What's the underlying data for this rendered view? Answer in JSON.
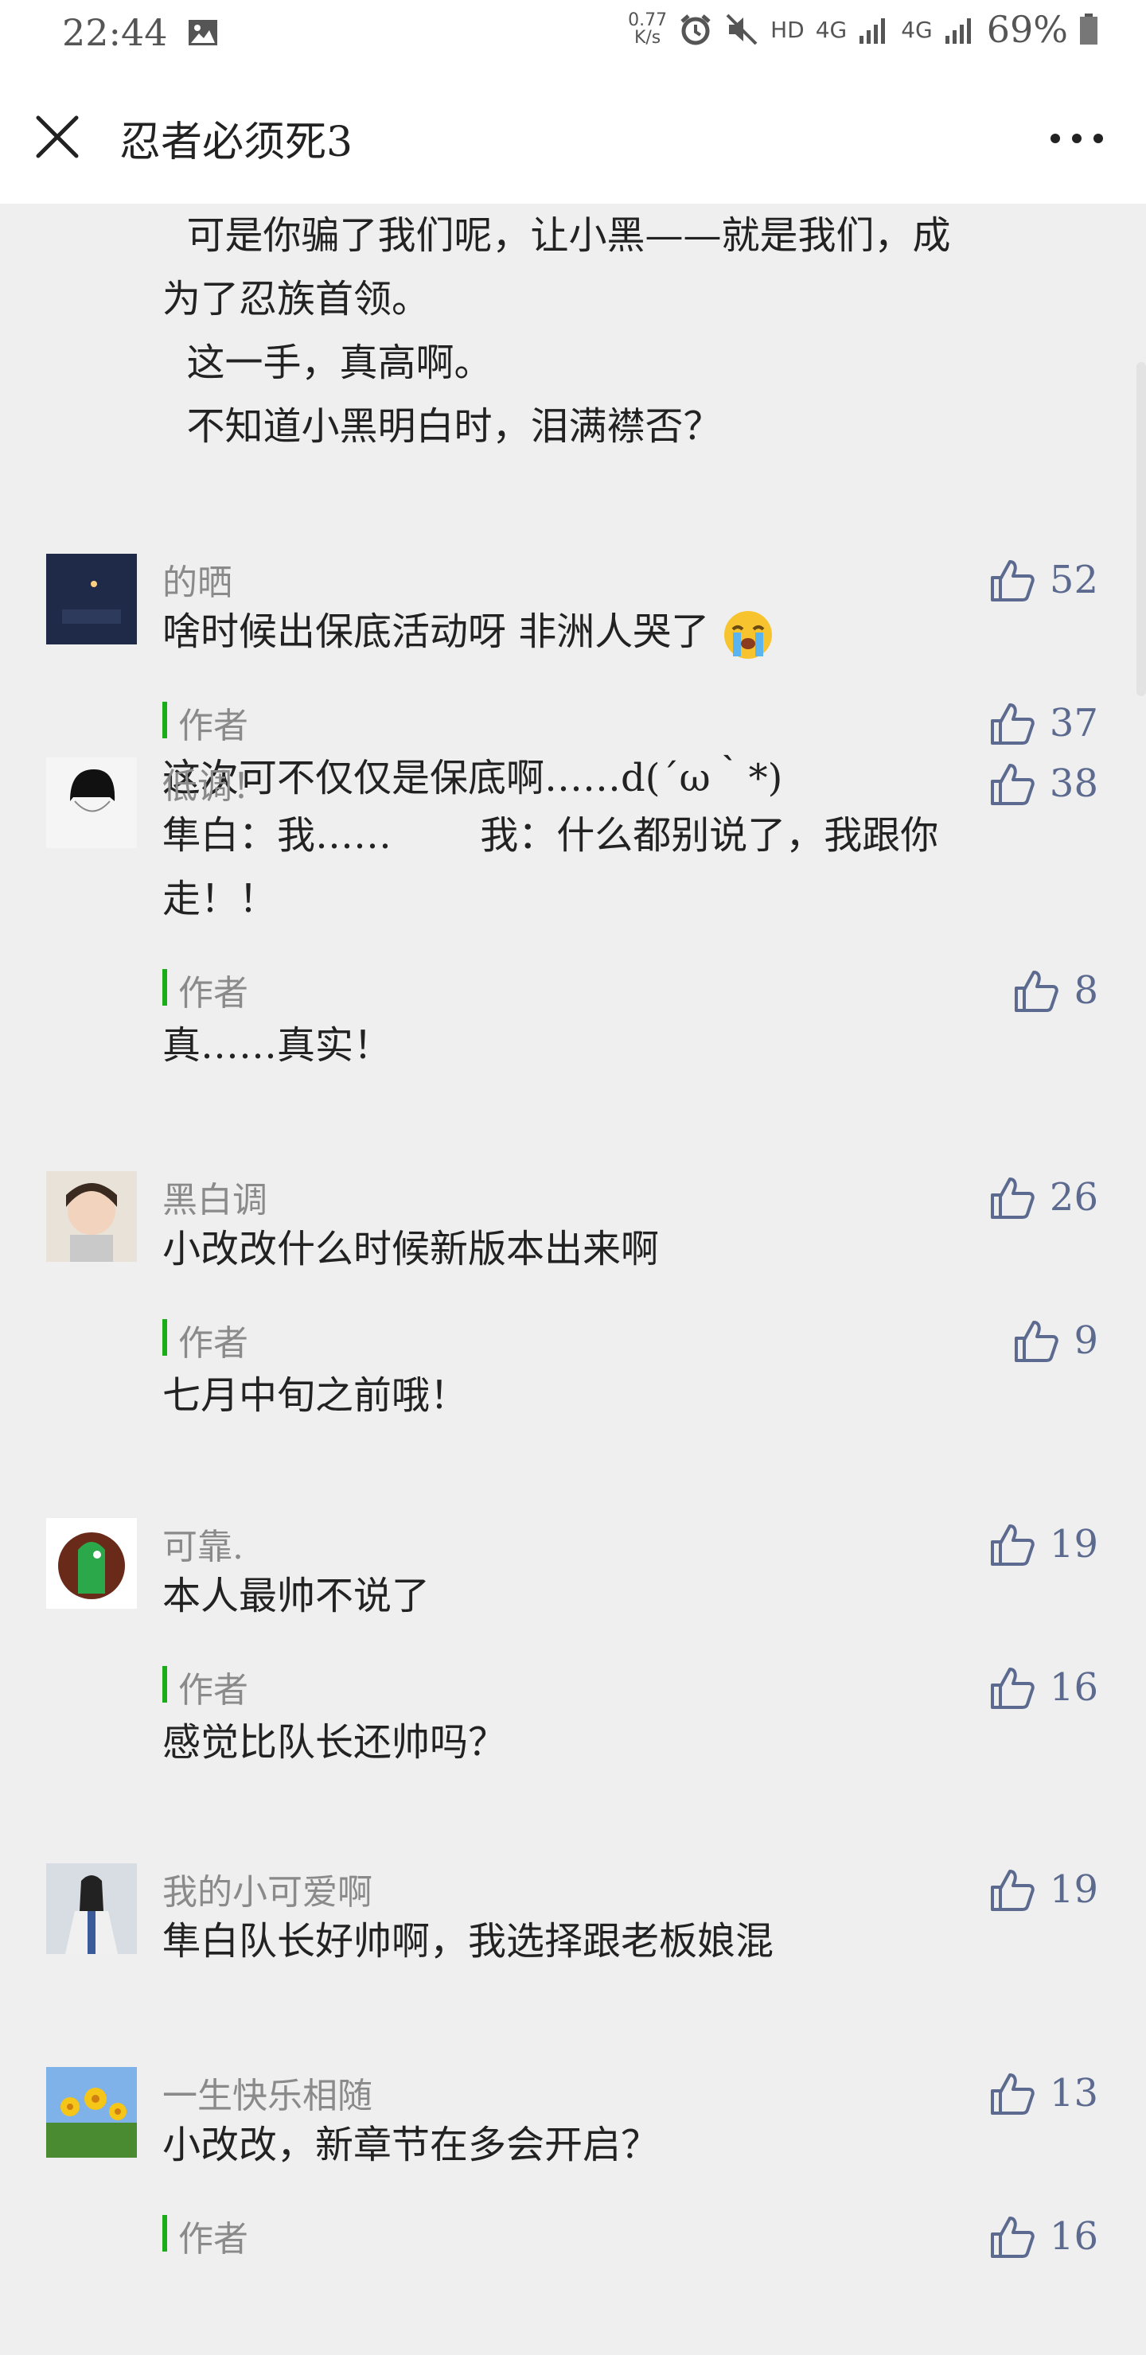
{
  "status_bar": {
    "time": "22:44",
    "net_speed_value": "0.77",
    "net_speed_unit": "K/s",
    "hd": "HD",
    "net1": "4G",
    "net2": "4G",
    "battery": "69%"
  },
  "header": {
    "title": "忍者必须死3"
  },
  "intro_lines": [
    "  可是你骗了我们呢，让小黑——就是我们，成",
    "为了忍族首领。",
    "  这一手，真高啊。",
    "  不知道小黑明白时，泪满襟否？"
  ],
  "comments": [
    {
      "name": "的晒",
      "text": "啥时候出保底活动呀 非洲人哭了",
      "likes": "52",
      "reply": {
        "label": "作者",
        "text": "这次可不仅仅是保底啊……d(´ω｀*)",
        "likes": "37"
      }
    },
    {
      "name": "低调！",
      "text_line1": "隼白：我……　　 我：什么都别说了，我跟你",
      "text_line2": "走！！",
      "likes": "38",
      "reply": {
        "label": "作者",
        "text": "真……真实！",
        "likes": "8"
      }
    },
    {
      "name": "黑白调",
      "text": "小改改什么时候新版本出来啊",
      "likes": "26",
      "reply": {
        "label": "作者",
        "text": "七月中旬之前哦！",
        "likes": "9"
      }
    },
    {
      "name": "可靠.",
      "text": "本人最帅不说了",
      "likes": "19",
      "reply": {
        "label": "作者",
        "text": "感觉比队长还帅吗？",
        "likes": "16"
      }
    },
    {
      "name": "我的小可爱啊",
      "text": "隼白队长好帅啊，我选择跟老板娘混",
      "likes": "19"
    },
    {
      "name": "一生快乐相随",
      "text": "小改改，新章节在多会开启？",
      "likes": "13",
      "reply": {
        "label": "作者",
        "likes": "16"
      }
    }
  ],
  "colors": {
    "accent_bar": "#1aad19",
    "like_blue": "#5b6a8e"
  }
}
